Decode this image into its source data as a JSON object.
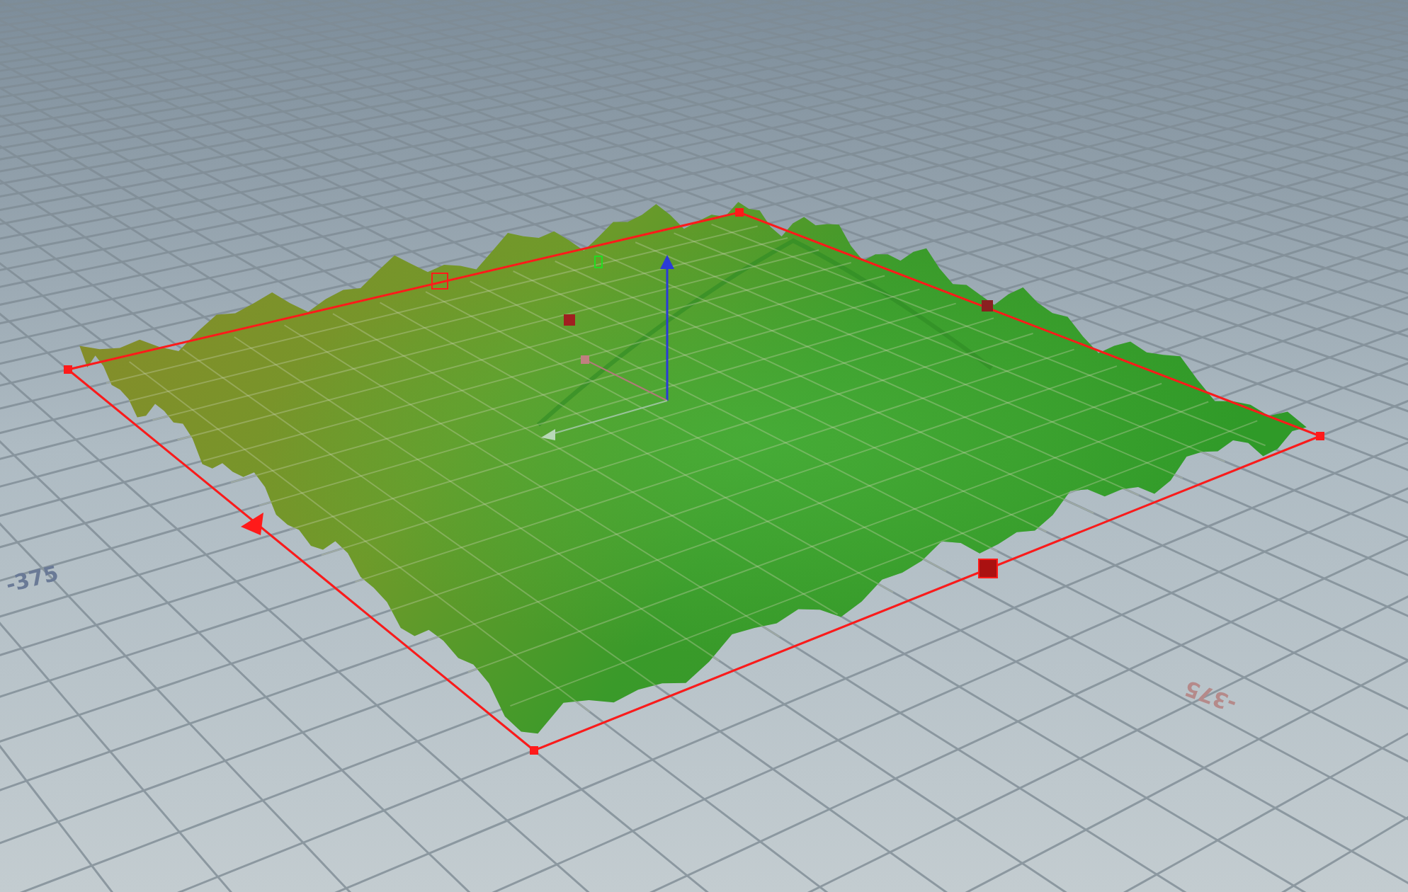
{
  "viewport": {
    "axis_labels": [
      {
        "text": "-375"
      },
      {
        "text": "-375"
      }
    ]
  }
}
